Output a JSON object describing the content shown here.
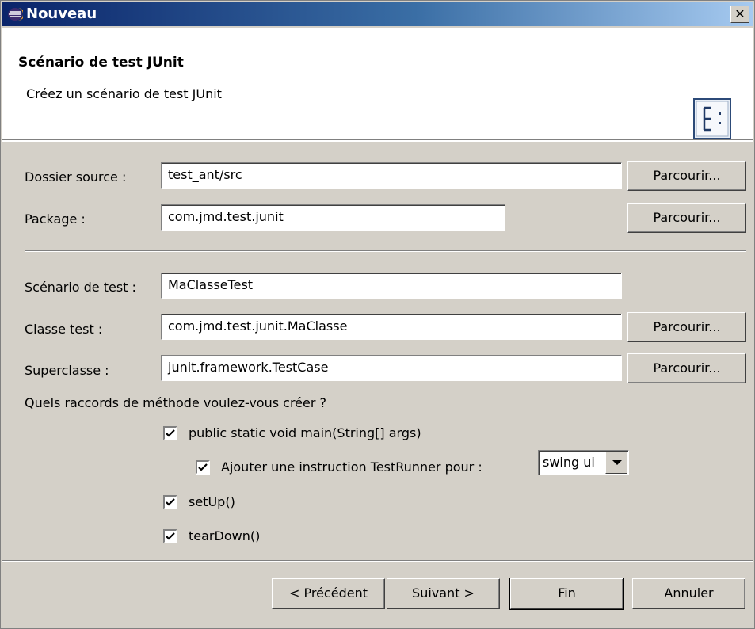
{
  "window": {
    "title": "Nouveau",
    "close_symbol": "✕"
  },
  "header": {
    "title": "Scénario de test JUnit",
    "description": "Créez un scénario de test JUnit",
    "icon": "junit-wizard-icon"
  },
  "form": {
    "source_folder": {
      "label": "Dossier source :",
      "value": "test_ant/src",
      "browse": "Parcourir..."
    },
    "package": {
      "label": "Package :",
      "value": "com.jmd.test.junit",
      "browse": "Parcourir..."
    },
    "test_case": {
      "label": "Scénario de test :",
      "value": "MaClasseTest"
    },
    "class_under_test": {
      "label": "Classe test :",
      "value": "com.jmd.test.junit.MaClasse",
      "browse": "Parcourir..."
    },
    "superclass": {
      "label": "Superclasse :",
      "value": "junit.framework.TestCase",
      "browse": "Parcourir..."
    },
    "stubs_question": "Quels raccords de méthode voulez-vous créer ?",
    "stubs": {
      "main": {
        "label": "public static void main(String[] args)",
        "checked": true
      },
      "testrunner": {
        "label": "Ajouter une instruction TestRunner pour :",
        "checked": true,
        "runner": "swing ui"
      },
      "setup": {
        "label": "setUp()",
        "checked": true
      },
      "teardown": {
        "label": "tearDown()",
        "checked": true
      }
    }
  },
  "footer": {
    "back": "< Précédent",
    "next": "Suivant >",
    "finish": "Fin",
    "cancel": "Annuler"
  }
}
